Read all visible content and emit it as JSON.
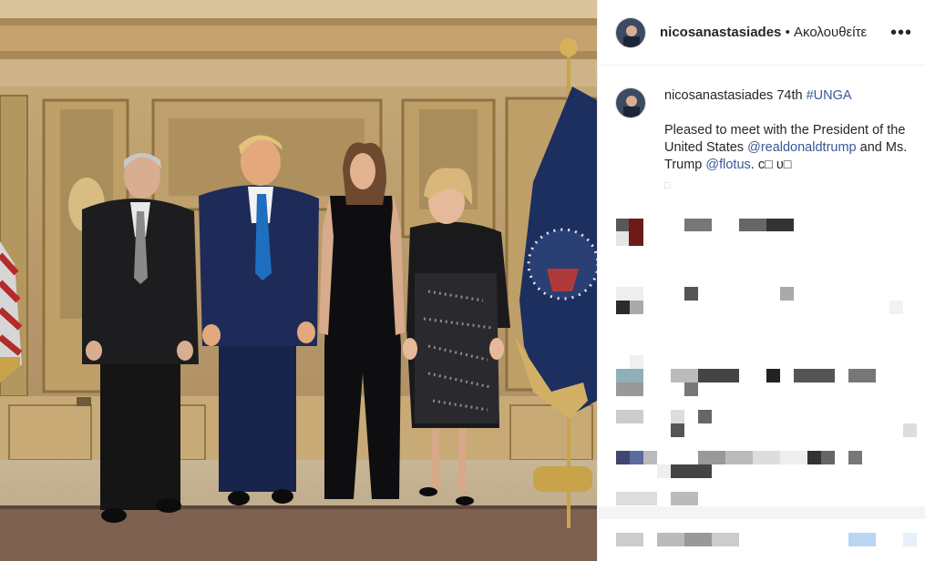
{
  "post": {
    "username": "nicosanastasiades",
    "separator": "•",
    "follow_status": "Ακολουθείτε",
    "more_icon": "more-horizontal-icon"
  },
  "caption": {
    "username": "nicosanastasiades",
    "prefix": "74th",
    "hashtag": "#UNGA",
    "line1": "Pleased to meet with the President of the United States",
    "mention1": "@realdonaldtrump",
    "line2": "and Ms. Trump",
    "mention2": "@flotus",
    "suffix": ". c□ υ□",
    "partial": "□"
  },
  "photo": {
    "description_icon": "photo-image",
    "palette": {
      "wall": "#b8996a",
      "wall_dark": "#8a6e44",
      "carpet": "#7a5b48",
      "floor": "#c9b89b"
    }
  },
  "colors": {
    "link": "#385898",
    "text": "#262626",
    "border": "#efefef"
  }
}
